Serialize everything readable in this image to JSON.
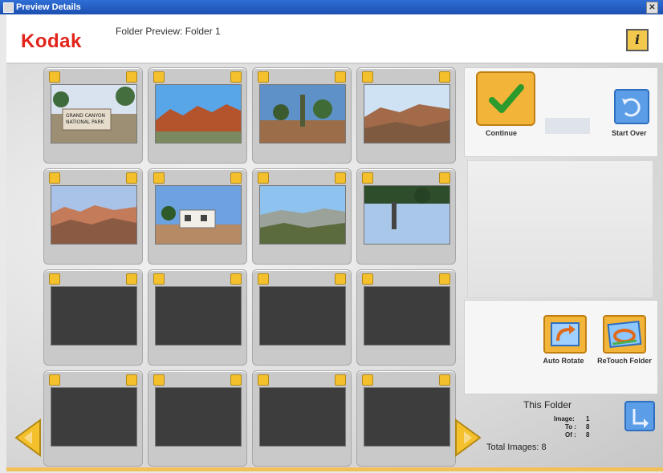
{
  "window": {
    "title": "Preview Details",
    "close_glyph": "✕"
  },
  "header": {
    "logo_text": "Kodak",
    "folder_title": "Folder Preview: Folder 1",
    "info_label": "i"
  },
  "grid": {
    "rows": 4,
    "cols": 4,
    "images": [
      {
        "id": "1",
        "scene": "sign"
      },
      {
        "id": "2",
        "scene": "canyon-red"
      },
      {
        "id": "3",
        "scene": "palms"
      },
      {
        "id": "4",
        "scene": "canyon"
      },
      {
        "id": "5",
        "scene": "canyon-wide"
      },
      {
        "id": "6",
        "scene": "house"
      },
      {
        "id": "7",
        "scene": "valley"
      },
      {
        "id": "8",
        "scene": "reflection"
      },
      {
        "id": "9",
        "scene": "empty"
      },
      {
        "id": "10",
        "scene": "empty"
      },
      {
        "id": "11",
        "scene": "empty"
      },
      {
        "id": "12",
        "scene": "empty"
      },
      {
        "id": "13",
        "scene": "empty"
      },
      {
        "id": "14",
        "scene": "empty"
      },
      {
        "id": "15",
        "scene": "empty"
      },
      {
        "id": "16",
        "scene": "empty"
      }
    ]
  },
  "right_panel": {
    "continue_label": "Continue",
    "startover_label": "Start Over",
    "auto_rotate_label": "Auto Rotate",
    "retouch_label": "ReTouch Folder",
    "stats": {
      "title": "This Folder",
      "image_label": "Image:",
      "image_value": "1",
      "to_label": "To :",
      "to_value": "8",
      "of_label": "Of :",
      "of_value": "8",
      "total_label": "Total Images: 8"
    }
  },
  "colors": {
    "kodak_red": "#e2231a",
    "accent_yellow": "#f3b43a",
    "accent_blue": "#5b9de6"
  }
}
